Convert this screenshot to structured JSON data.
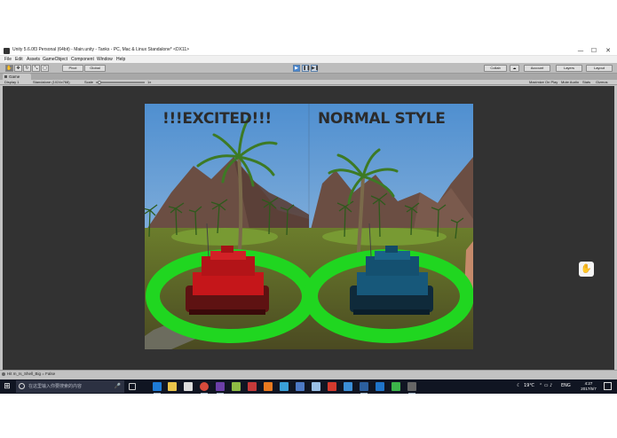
{
  "window": {
    "title": "Unity 5.6.0f3 Personal (64bit) - Main.unity - Tanks - PC, Mac & Linux Standalone* <DX11>",
    "minimize": "—",
    "maximize": "☐",
    "close": "✕"
  },
  "menu": [
    "File",
    "Edit",
    "Assets",
    "GameObject",
    "Component",
    "Window",
    "Help"
  ],
  "toolbar": {
    "pivot_label": "Pivot",
    "global_label": "Global",
    "collab_label": "Collab",
    "account_label": "Account",
    "layers_label": "Layers",
    "layout_label": "Layout"
  },
  "game_tab": {
    "label": "Game",
    "display_label": "Display 1",
    "resolution_label": "Standalone (1024x768)",
    "scale_label": "Scale",
    "scale_value": "1x",
    "maximize_label": "Maximize On Play",
    "mute_label": "Mute Audio",
    "stats_label": "Stats",
    "gizmos_label": "Gizmos"
  },
  "game": {
    "left_caption": "!!!EXCITED!!!",
    "right_caption": "NORMAL STYLE",
    "left_tank_color": "#c5161a",
    "right_tank_color": "#17587a",
    "ring_color": "#20d620",
    "sky_color": "#5b9bd8"
  },
  "status": {
    "message": "Hit m_Is_Shell_Big = False"
  },
  "taskbar": {
    "search_placeholder": "在这里输入你要搜索的内容",
    "temperature": "19℃",
    "ime": "ENG",
    "time": "4:27",
    "date": "2017/5/7"
  },
  "icons": [
    "unity-logo-icon",
    "hand-tool-icon",
    "move-tool-icon",
    "rotate-tool-icon",
    "scale-tool-icon",
    "rect-tool-icon",
    "play-icon",
    "pause-icon",
    "step-icon",
    "cloud-icon",
    "windows-start-icon",
    "search-icon",
    "microphone-icon",
    "task-view-icon",
    "edge-icon",
    "file-explorer-icon",
    "store-icon",
    "chrome-icon",
    "visual-studio-icon",
    "unity-taskbar-icon",
    "notification-icon"
  ]
}
